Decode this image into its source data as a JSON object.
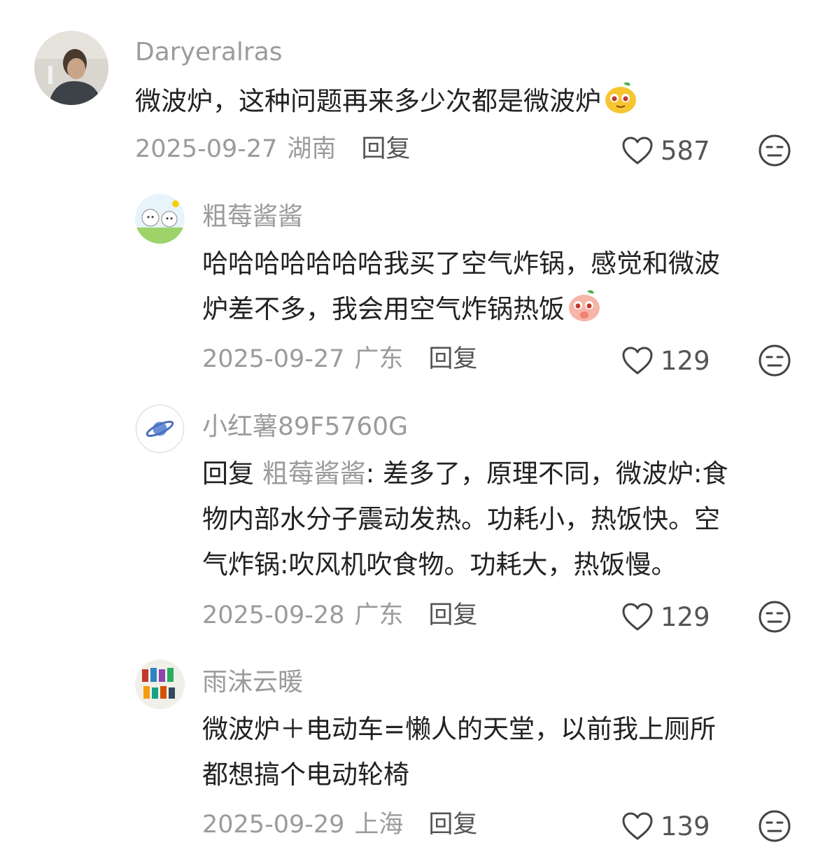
{
  "comments": [
    {
      "username": "Daryeralras",
      "text": "微波炉，这种问题再来多少次都是微波炉",
      "sticker": "pear-face-sticker",
      "date": "2025-09-27",
      "location": "湖南",
      "reply_label": "回复",
      "likes": "587"
    },
    {
      "username": "粗莓酱酱",
      "text_line1": "哈哈哈哈哈哈哈我买了空气炸锅，感觉和微波",
      "text_line2": "炉差不多，我会用空气炸锅热饭",
      "sticker": "peach-face-sticker",
      "date": "2025-09-27",
      "location": "广东",
      "reply_label": "回复",
      "likes": "129"
    },
    {
      "username": "小红薯89F5760G",
      "reply_prefix": "回复",
      "reply_target": "粗莓酱酱",
      "text_line1_rest": ": 差多了，原理不同，微波炉:食",
      "text_line2": "物内部水分子震动发热。功耗小，热饭快。空",
      "text_line3": "气炸锅:吹风机吹食物。功耗大，热饭慢。",
      "date": "2025-09-28",
      "location": "广东",
      "reply_label": "回复",
      "likes": "129"
    },
    {
      "username": "雨沫云暖",
      "text_line1": "微波炉＋电动车=懒人的天堂，以前我上厕所",
      "text_line2": "都想搞个电动轮椅",
      "date": "2025-09-29",
      "location": "上海",
      "reply_label": "回复",
      "likes": "139"
    }
  ],
  "icons": {
    "like": "heart-outline-icon",
    "dislike": "meh-face-icon"
  },
  "colors": {
    "text_primary": "#222222",
    "text_secondary": "#9b9b9b",
    "icon": "#555555"
  }
}
